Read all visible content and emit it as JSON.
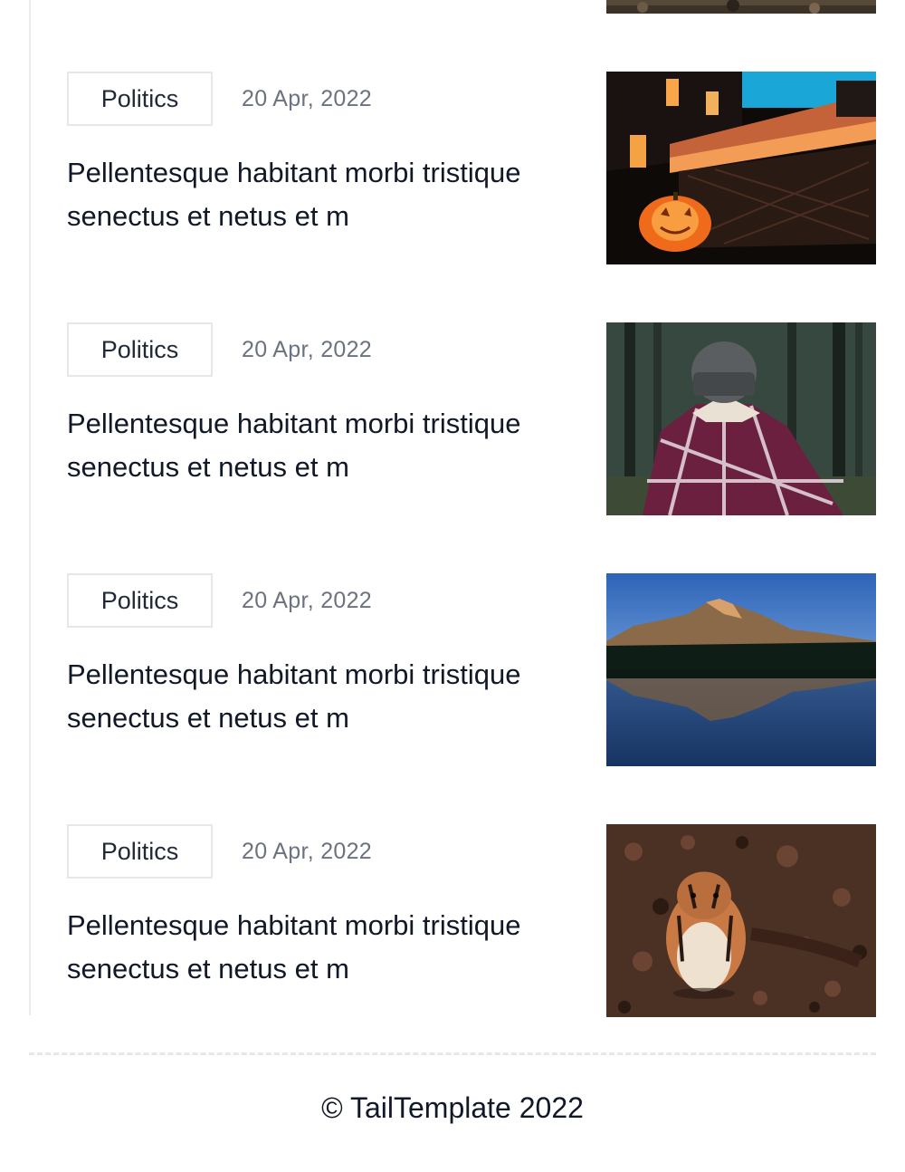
{
  "articles": [
    {
      "category": "Politics",
      "date": "20 Apr, 2022",
      "title": "Pellentesque habitant morbi tristique senectus et netus et m"
    },
    {
      "category": "Politics",
      "date": "20 Apr, 2022",
      "title": "Pellentesque habitant morbi tristique senectus et netus et m"
    },
    {
      "category": "Politics",
      "date": "20 Apr, 2022",
      "title": "Pellentesque habitant morbi tristique senectus et netus et m"
    },
    {
      "category": "Politics",
      "date": "20 Apr, 2022",
      "title": "Pellentesque habitant morbi tristique senectus et netus et m"
    }
  ],
  "footer": {
    "copyright": "© TailTemplate 2022"
  },
  "colors": {
    "tag_border": "#e5e7eb",
    "date_text": "#6b7280",
    "title_text": "#111827"
  }
}
